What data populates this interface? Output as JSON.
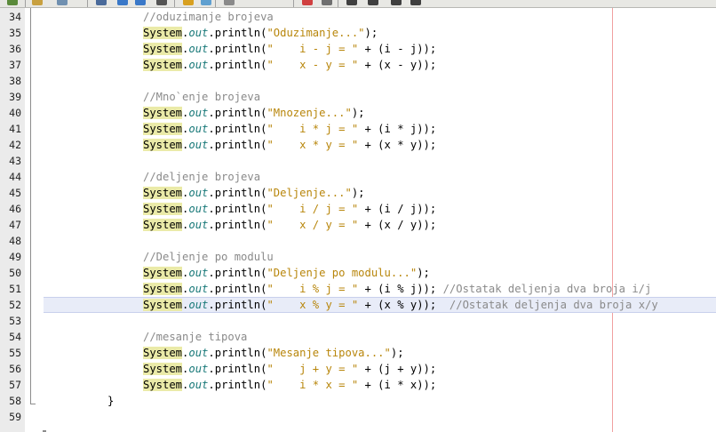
{
  "editor": {
    "colors": {
      "comment": "#8a8a8a",
      "string": "#b8860b",
      "highlight": "#eaeaa8",
      "current_line": "#e8ecf8",
      "margin": "#f0a0a0"
    },
    "toolbar_icons": [
      "new-file-icon",
      "open-icon",
      "save-icon",
      "find-icon",
      "back-icon",
      "forward-icon",
      "toggle-icon",
      "up-icon",
      "clear-icon",
      "debug-icon",
      "run-icon",
      "stop-icon",
      "shift-left-icon",
      "shift-right-icon",
      "comment-icon",
      "uncomment-icon"
    ]
  },
  "code": {
    "lines": [
      {
        "n": "34",
        "indent": "",
        "segs": [
          {
            "t": "//oduzimanje brojeva",
            "c": "cm"
          }
        ]
      },
      {
        "n": "35",
        "segs": [
          {
            "t": "System",
            "c": "sys"
          },
          {
            "t": ".",
            "c": ""
          },
          {
            "t": "out",
            "c": "out"
          },
          {
            "t": ".println(",
            "c": ""
          },
          {
            "t": "\"Oduzimanje...\"",
            "c": "st"
          },
          {
            "t": ");",
            "c": ""
          }
        ]
      },
      {
        "n": "36",
        "segs": [
          {
            "t": "System",
            "c": "sys"
          },
          {
            "t": ".",
            "c": ""
          },
          {
            "t": "out",
            "c": "out"
          },
          {
            "t": ".println(",
            "c": ""
          },
          {
            "t": "\"    i - j = \"",
            "c": "st"
          },
          {
            "t": " + (i - j));",
            "c": ""
          }
        ]
      },
      {
        "n": "37",
        "segs": [
          {
            "t": "System",
            "c": "sys"
          },
          {
            "t": ".",
            "c": ""
          },
          {
            "t": "out",
            "c": "out"
          },
          {
            "t": ".println(",
            "c": ""
          },
          {
            "t": "\"    x - y = \"",
            "c": "st"
          },
          {
            "t": " + (x - y));",
            "c": ""
          }
        ]
      },
      {
        "n": "38",
        "segs": []
      },
      {
        "n": "39",
        "segs": [
          {
            "t": "//Mno`enje brojeva",
            "c": "cm"
          }
        ]
      },
      {
        "n": "40",
        "segs": [
          {
            "t": "System",
            "c": "sys"
          },
          {
            "t": ".",
            "c": ""
          },
          {
            "t": "out",
            "c": "out"
          },
          {
            "t": ".println(",
            "c": ""
          },
          {
            "t": "\"Mnozenje...\"",
            "c": "st"
          },
          {
            "t": ");",
            "c": ""
          }
        ]
      },
      {
        "n": "41",
        "segs": [
          {
            "t": "System",
            "c": "sys"
          },
          {
            "t": ".",
            "c": ""
          },
          {
            "t": "out",
            "c": "out"
          },
          {
            "t": ".println(",
            "c": ""
          },
          {
            "t": "\"    i * j = \"",
            "c": "st"
          },
          {
            "t": " + (i * j));",
            "c": ""
          }
        ]
      },
      {
        "n": "42",
        "segs": [
          {
            "t": "System",
            "c": "sys"
          },
          {
            "t": ".",
            "c": ""
          },
          {
            "t": "out",
            "c": "out"
          },
          {
            "t": ".println(",
            "c": ""
          },
          {
            "t": "\"    x * y = \"",
            "c": "st"
          },
          {
            "t": " + (x * y));",
            "c": ""
          }
        ]
      },
      {
        "n": "43",
        "segs": []
      },
      {
        "n": "44",
        "segs": [
          {
            "t": "//deljenje brojeva",
            "c": "cm"
          }
        ]
      },
      {
        "n": "45",
        "segs": [
          {
            "t": "System",
            "c": "sys"
          },
          {
            "t": ".",
            "c": ""
          },
          {
            "t": "out",
            "c": "out"
          },
          {
            "t": ".println(",
            "c": ""
          },
          {
            "t": "\"Deljenje...\"",
            "c": "st"
          },
          {
            "t": ");",
            "c": ""
          }
        ]
      },
      {
        "n": "46",
        "segs": [
          {
            "t": "System",
            "c": "sys"
          },
          {
            "t": ".",
            "c": ""
          },
          {
            "t": "out",
            "c": "out"
          },
          {
            "t": ".println(",
            "c": ""
          },
          {
            "t": "\"    i / j = \"",
            "c": "st"
          },
          {
            "t": " + (i / j));",
            "c": ""
          }
        ]
      },
      {
        "n": "47",
        "segs": [
          {
            "t": "System",
            "c": "sys"
          },
          {
            "t": ".",
            "c": ""
          },
          {
            "t": "out",
            "c": "out"
          },
          {
            "t": ".println(",
            "c": ""
          },
          {
            "t": "\"    x / y = \"",
            "c": "st"
          },
          {
            "t": " + (x / y));",
            "c": ""
          }
        ]
      },
      {
        "n": "48",
        "segs": []
      },
      {
        "n": "49",
        "segs": [
          {
            "t": "//Deljenje po modulu",
            "c": "cm"
          }
        ]
      },
      {
        "n": "50",
        "segs": [
          {
            "t": "System",
            "c": "sys"
          },
          {
            "t": ".",
            "c": ""
          },
          {
            "t": "out",
            "c": "out"
          },
          {
            "t": ".println(",
            "c": ""
          },
          {
            "t": "\"Deljenje po modulu...\"",
            "c": "st"
          },
          {
            "t": ");",
            "c": ""
          }
        ]
      },
      {
        "n": "51",
        "segs": [
          {
            "t": "System",
            "c": "sys"
          },
          {
            "t": ".",
            "c": ""
          },
          {
            "t": "out",
            "c": "out"
          },
          {
            "t": ".println(",
            "c": ""
          },
          {
            "t": "\"    i % j = \"",
            "c": "st"
          },
          {
            "t": " + (i % j)); ",
            "c": ""
          },
          {
            "t": "//Ostatak deljenja dva broja i/j",
            "c": "cm"
          }
        ]
      },
      {
        "n": "52",
        "current": true,
        "segs": [
          {
            "t": "System",
            "c": "sys"
          },
          {
            "t": ".",
            "c": ""
          },
          {
            "t": "out",
            "c": "out"
          },
          {
            "t": ".println(",
            "c": ""
          },
          {
            "t": "\"    x % y = \"",
            "c": "st"
          },
          {
            "t": " + (x % y));  ",
            "c": ""
          },
          {
            "t": "//Ostatak deljenja dva broja x/y",
            "c": "cm"
          }
        ]
      },
      {
        "n": "53",
        "segs": []
      },
      {
        "n": "54",
        "segs": [
          {
            "t": "//mesanje tipova",
            "c": "cm"
          }
        ]
      },
      {
        "n": "55",
        "segs": [
          {
            "t": "System",
            "c": "sys"
          },
          {
            "t": ".",
            "c": ""
          },
          {
            "t": "out",
            "c": "out"
          },
          {
            "t": ".println(",
            "c": ""
          },
          {
            "t": "\"Mesanje tipova...\"",
            "c": "st"
          },
          {
            "t": ");",
            "c": ""
          }
        ]
      },
      {
        "n": "56",
        "segs": [
          {
            "t": "System",
            "c": "sys"
          },
          {
            "t": ".",
            "c": ""
          },
          {
            "t": "out",
            "c": "out"
          },
          {
            "t": ".println(",
            "c": ""
          },
          {
            "t": "\"    j + y = \"",
            "c": "st"
          },
          {
            "t": " + (j + y));",
            "c": ""
          }
        ]
      },
      {
        "n": "57",
        "segs": [
          {
            "t": "System",
            "c": "sys"
          },
          {
            "t": ".",
            "c": ""
          },
          {
            "t": "out",
            "c": "out"
          },
          {
            "t": ".println(",
            "c": ""
          },
          {
            "t": "\"    i * x = \"",
            "c": "st"
          },
          {
            "t": " + (i * x));",
            "c": ""
          }
        ]
      },
      {
        "n": "58",
        "brace": true,
        "segs": [
          {
            "t": "}",
            "c": ""
          }
        ]
      },
      {
        "n": "59",
        "segs": []
      }
    ]
  }
}
